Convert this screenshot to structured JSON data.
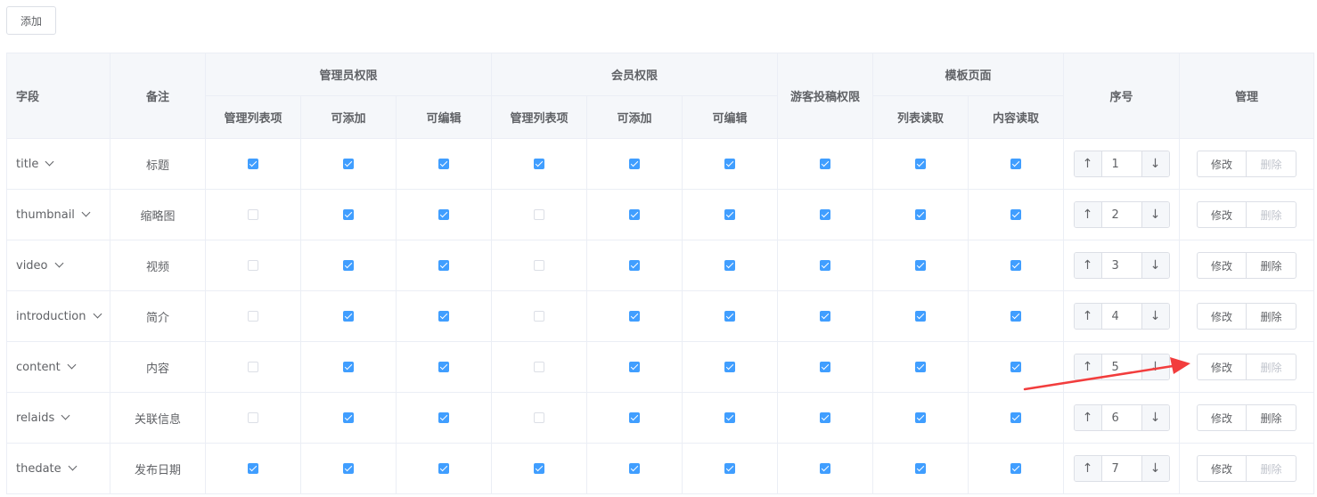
{
  "toolbar": {
    "add_label": "添加"
  },
  "headers": {
    "field": "字段",
    "note": "备注",
    "admin_group": "管理员权限",
    "member_group": "会员权限",
    "guest": "游客投稿权限",
    "template_group": "模板页面",
    "order": "序号",
    "manage": "管理",
    "admin_list": "管理列表项",
    "admin_add": "可添加",
    "admin_edit": "可编辑",
    "member_list": "管理列表项",
    "member_add": "可添加",
    "member_edit": "可编辑",
    "tpl_list": "列表读取",
    "tpl_content": "内容读取"
  },
  "rows": [
    {
      "field": "title",
      "note": "标题",
      "admin_list": true,
      "admin_add": true,
      "admin_edit": true,
      "member_list": true,
      "member_add": true,
      "member_edit": true,
      "guest": true,
      "tpl_list": true,
      "tpl_content": true,
      "order": "1",
      "edit_label": "修改",
      "delete_label": "删除",
      "delete_enabled": false
    },
    {
      "field": "thumbnail",
      "note": "缩略图",
      "admin_list": false,
      "admin_add": true,
      "admin_edit": true,
      "member_list": false,
      "member_add": true,
      "member_edit": true,
      "guest": true,
      "tpl_list": true,
      "tpl_content": true,
      "order": "2",
      "edit_label": "修改",
      "delete_label": "删除",
      "delete_enabled": false
    },
    {
      "field": "video",
      "note": "视频",
      "admin_list": false,
      "admin_add": true,
      "admin_edit": true,
      "member_list": false,
      "member_add": true,
      "member_edit": true,
      "guest": true,
      "tpl_list": true,
      "tpl_content": true,
      "order": "3",
      "edit_label": "修改",
      "delete_label": "删除",
      "delete_enabled": true
    },
    {
      "field": "introduction",
      "note": "简介",
      "admin_list": false,
      "admin_add": true,
      "admin_edit": true,
      "member_list": false,
      "member_add": true,
      "member_edit": true,
      "guest": true,
      "tpl_list": true,
      "tpl_content": true,
      "order": "4",
      "edit_label": "修改",
      "delete_label": "删除",
      "delete_enabled": true
    },
    {
      "field": "content",
      "note": "内容",
      "admin_list": false,
      "admin_add": true,
      "admin_edit": true,
      "member_list": false,
      "member_add": true,
      "member_edit": true,
      "guest": true,
      "tpl_list": true,
      "tpl_content": true,
      "order": "5",
      "edit_label": "修改",
      "delete_label": "删除",
      "delete_enabled": false
    },
    {
      "field": "relaids",
      "note": "关联信息",
      "admin_list": false,
      "admin_add": true,
      "admin_edit": true,
      "member_list": false,
      "member_add": true,
      "member_edit": true,
      "guest": true,
      "tpl_list": true,
      "tpl_content": true,
      "order": "6",
      "edit_label": "修改",
      "delete_label": "删除",
      "delete_enabled": true
    },
    {
      "field": "thedate",
      "note": "发布日期",
      "admin_list": true,
      "admin_add": true,
      "admin_edit": true,
      "member_list": true,
      "member_add": true,
      "member_edit": true,
      "guest": true,
      "tpl_list": true,
      "tpl_content": true,
      "order": "7",
      "edit_label": "修改",
      "delete_label": "删除",
      "delete_enabled": false
    }
  ],
  "icons": {
    "step_up": "↑",
    "step_down": "↓",
    "dropdown": "chevron-down-icon",
    "annotation": "red-arrow-annotation"
  },
  "colors": {
    "checkbox_checked": "#409eff",
    "header_bg": "#f5f7fa",
    "border": "#ebeef5",
    "annotation_arrow": "#f23d3d"
  }
}
